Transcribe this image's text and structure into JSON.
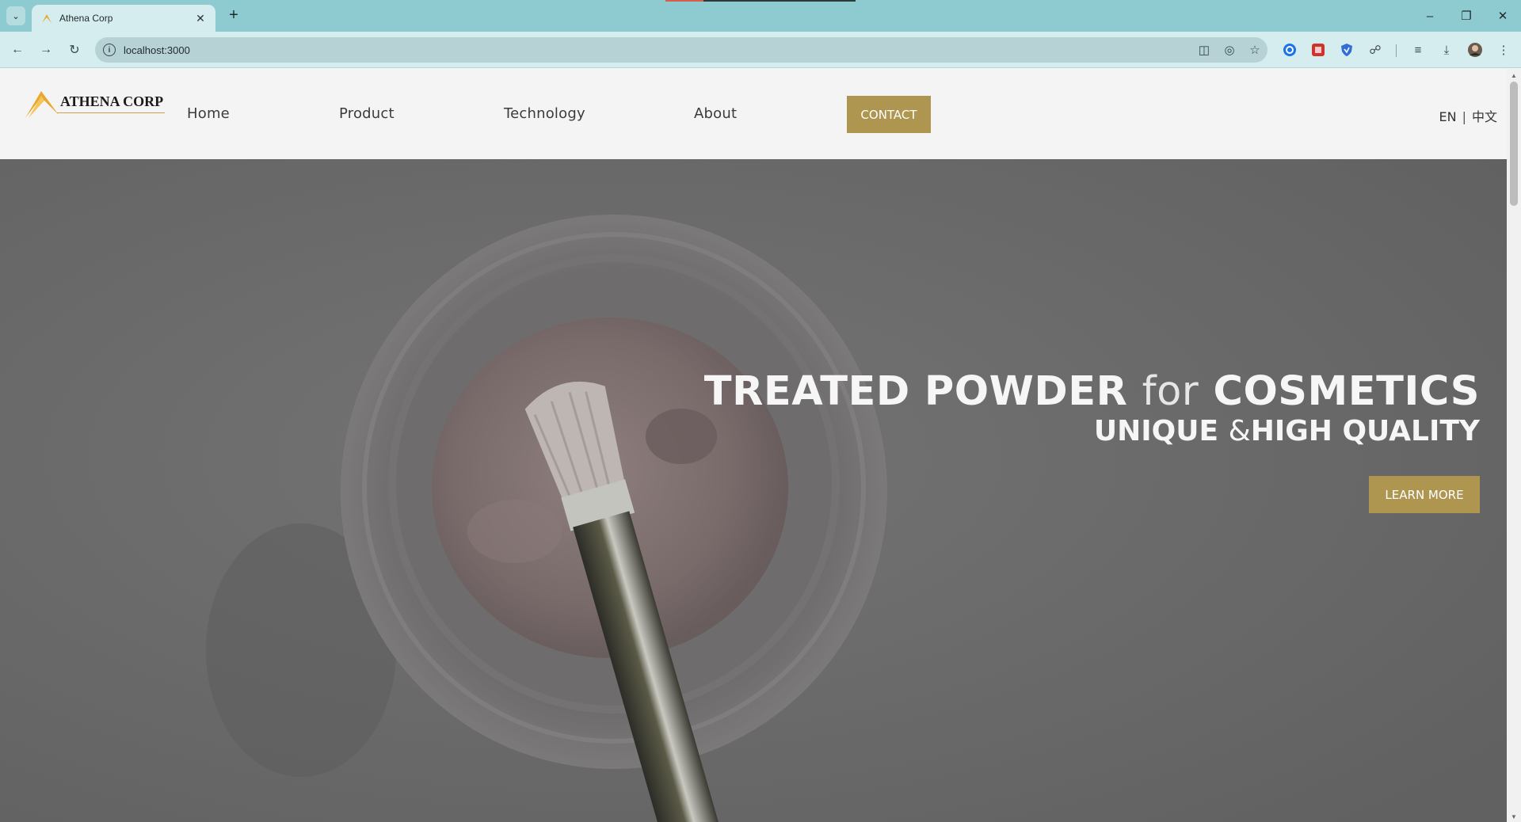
{
  "browser": {
    "tab_title": "Athena Corp",
    "new_tab_label": "+",
    "url": "localhost:3000",
    "icons": [
      "tab-search-icon",
      "favicon-icon",
      "close-icon",
      "back-icon",
      "forward-icon",
      "reload-icon",
      "site-info-icon",
      "install-icon",
      "eye-off-icon",
      "star-icon",
      "extension-icon",
      "puzzle-icon",
      "reading-list-icon",
      "download-icon",
      "profile-avatar-icon",
      "kebab-menu-icon"
    ]
  },
  "header": {
    "logo_text": "ATHENA CORP",
    "nav": {
      "home": "Home",
      "product": "Product",
      "technology": "Technology",
      "about": "About",
      "contact": "CONTACT"
    },
    "lang": {
      "en": "EN",
      "sep": "|",
      "zh": "中文"
    }
  },
  "hero": {
    "title_part1": "TREATED POWDER",
    "title_for": "for",
    "title_part2": "COSMETICS",
    "subtitle_part1": "UNIQUE",
    "subtitle_amp": "&",
    "subtitle_part2": "HIGH QUALITY",
    "cta": "LEARN MORE"
  },
  "colors": {
    "accent": "#ae9550",
    "chrome": "#8ecbd0",
    "hero_overlay": "#6a6a6a"
  }
}
